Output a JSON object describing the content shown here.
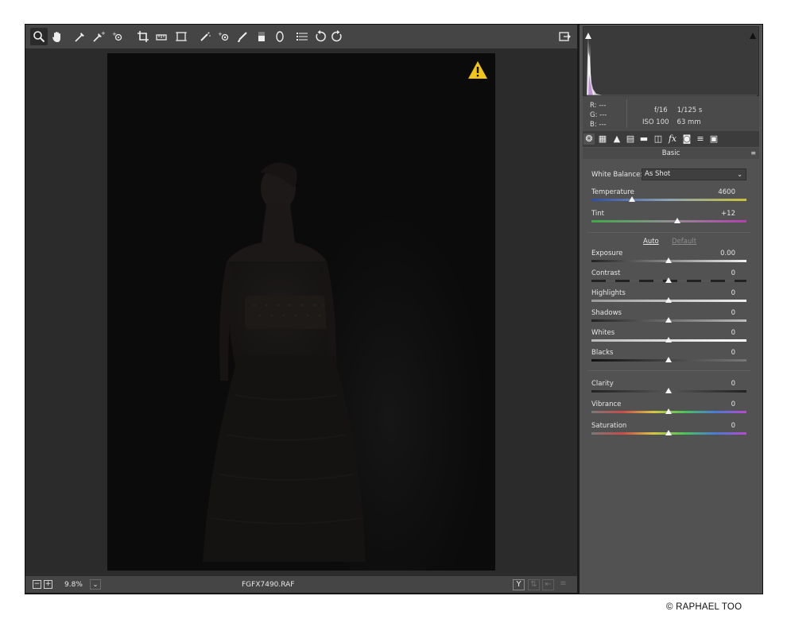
{
  "toolbar": {
    "tools": [
      "zoom-icon",
      "hand-icon",
      "white-balance-icon",
      "color-sampler-icon",
      "targeted-adjustment-icon",
      "crop-icon",
      "straighten-icon",
      "transform-icon",
      "spot-removal-icon",
      "red-eye-icon",
      "adjustment-brush-icon",
      "graduated-filter-icon",
      "radial-filter-icon",
      "preferences-icon",
      "rotate-ccw-icon",
      "rotate-cw-icon"
    ],
    "fullscreen_icon": "open-in-photoshop-icon"
  },
  "statusbar": {
    "zoom_out": "−",
    "zoom_in": "+",
    "zoom": "9.8%",
    "zoom_chevron": "⌄",
    "filename": "FGFX7490.RAF",
    "before_after": "Y"
  },
  "info": {
    "r": "R:   ---",
    "g": "G:   ---",
    "b": "B:   ---",
    "aperture": "f/16",
    "shutter": "1/125 s",
    "iso": "ISO 100",
    "focal": "63 mm"
  },
  "panel": {
    "section": "Basic",
    "white_balance_label": "White Balance:",
    "white_balance_value": "As Shot",
    "auto": "Auto",
    "default": "Default",
    "sliders": [
      {
        "label": "Temperature",
        "value": "4600"
      },
      {
        "label": "Tint",
        "value": "+12"
      },
      {
        "label": "Exposure",
        "value": "0.00"
      },
      {
        "label": "Contrast",
        "value": "0"
      },
      {
        "label": "Highlights",
        "value": "0"
      },
      {
        "label": "Shadows",
        "value": "0"
      },
      {
        "label": "Whites",
        "value": "0"
      },
      {
        "label": "Blacks",
        "value": "0"
      },
      {
        "label": "Clarity",
        "value": "0"
      },
      {
        "label": "Vibrance",
        "value": "0"
      },
      {
        "label": "Saturation",
        "value": "0"
      }
    ]
  },
  "credit": "© RAPHAEL TOO",
  "colors": {
    "panel_bg": "#525252",
    "toolbar_bg": "#454545",
    "canvas_bg": "#2b2b2b",
    "warning": "#f0c419"
  }
}
